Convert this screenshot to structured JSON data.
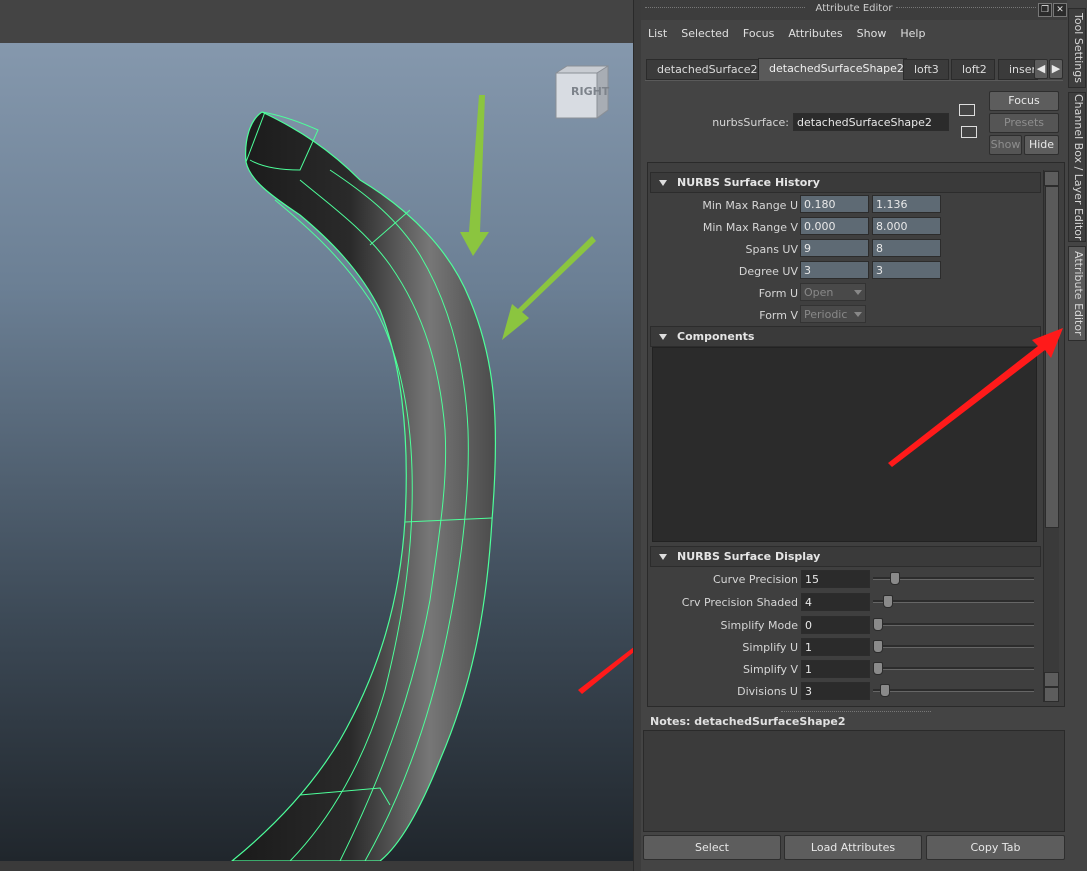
{
  "viewport": {
    "view_cube_label": "RIGHT"
  },
  "attribute_editor": {
    "title": "Attribute Editor",
    "menu": [
      "List",
      "Selected",
      "Focus",
      "Attributes",
      "Show",
      "Help"
    ],
    "tabs": [
      "detachedSurface2",
      "detachedSurfaceShape2",
      "loft3",
      "loft2",
      "inser"
    ],
    "active_tab": "detachedSurfaceShape2",
    "node_type_label": "nurbsSurface:",
    "node_name": "detachedSurfaceShape2",
    "buttons": {
      "focus": "Focus",
      "presets": "Presets",
      "show": "Show",
      "hide": "Hide"
    },
    "history_section": {
      "title": "NURBS Surface History",
      "rows": [
        {
          "label": "Min Max Range U",
          "v1": "0.180",
          "v2": "1.136"
        },
        {
          "label": "Min Max Range V",
          "v1": "0.000",
          "v2": "8.000"
        },
        {
          "label": "Spans UV",
          "v1": "9",
          "v2": "8"
        },
        {
          "label": "Degree UV",
          "v1": "3",
          "v2": "3"
        }
      ],
      "form_u_label": "Form U",
      "form_u_value": "Open",
      "form_v_label": "Form V",
      "form_v_value": "Periodic"
    },
    "components_section": {
      "title": "Components"
    },
    "display_section": {
      "title": "NURBS Surface Display",
      "rows": [
        {
          "label": "Curve Precision",
          "value": "15"
        },
        {
          "label": "Crv Precision Shaded",
          "value": "4"
        },
        {
          "label": "Simplify Mode",
          "value": "0"
        },
        {
          "label": "Simplify U",
          "value": "1"
        },
        {
          "label": "Simplify V",
          "value": "1"
        },
        {
          "label": "Divisions U",
          "value": "3"
        }
      ]
    },
    "notes_label": "Notes:  detachedSurfaceShape2",
    "notes_text": "",
    "bottom_buttons": [
      "Select",
      "Load Attributes",
      "Copy Tab"
    ]
  },
  "side_tabs": [
    "Tool Settings",
    "Channel Box / Layer Editor",
    "Attribute Editor"
  ],
  "colors": {
    "wire": "#4dff9a",
    "green_arrow": "#8bc53f",
    "red_arrow": "#ff1a1a"
  }
}
